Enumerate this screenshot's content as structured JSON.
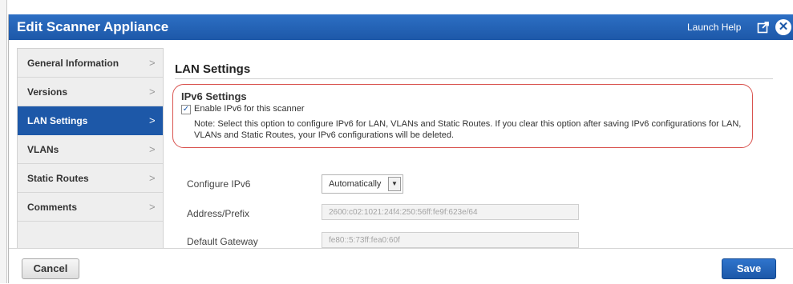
{
  "dialog": {
    "title": "Edit Scanner Appliance",
    "launch_help": "Launch Help",
    "popout_icon": "popout-icon",
    "close_icon": "close-icon",
    "colors": {
      "header": "#1d58a8",
      "accent_red": "#d9534f"
    }
  },
  "sidebar": {
    "items": [
      {
        "label": "General Information",
        "chevron": ">"
      },
      {
        "label": "Versions",
        "chevron": ">"
      },
      {
        "label": "LAN Settings",
        "chevron": ">",
        "active": true
      },
      {
        "label": "VLANs",
        "chevron": ">"
      },
      {
        "label": "Static Routes",
        "chevron": ">"
      },
      {
        "label": "Comments",
        "chevron": ">"
      }
    ]
  },
  "main": {
    "section_title": "LAN Settings",
    "ipv6": {
      "heading": "IPv6 Settings",
      "enable_label": "Enable IPv6 for this scanner",
      "enabled": true,
      "note": "Note: Select this option to configure IPv6 for LAN, VLANs and Static Routes. If you clear this option after saving IPv6 configurations for LAN, VLANs and Static Routes, your IPv6 configurations will be deleted."
    },
    "fields": {
      "configure_label": "Configure IPv6",
      "configure_value": "Automatically",
      "address_label": "Address/Prefix",
      "address_value": "2600:c02:1021:24f4:250:56ff:fe9f:623e/64",
      "gateway_label": "Default Gateway",
      "gateway_value": "fe80::5:73ff:fea0:60f"
    }
  },
  "footer": {
    "cancel_label": "Cancel",
    "save_label": "Save"
  }
}
